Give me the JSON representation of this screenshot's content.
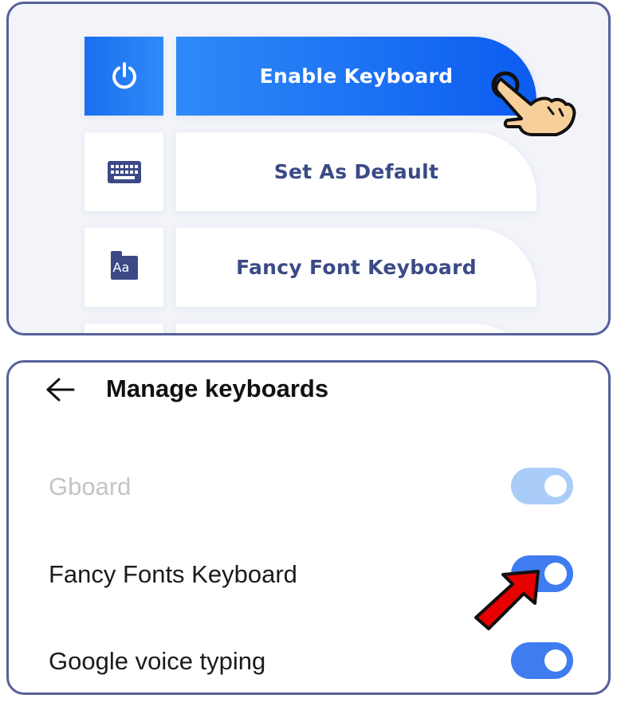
{
  "menu": {
    "items": [
      {
        "label": "Enable Keyboard",
        "icon": "power-icon",
        "active": true
      },
      {
        "label": "Set As Default",
        "icon": "keyboard-icon",
        "active": false
      },
      {
        "label": "Fancy Font Keyboard",
        "icon": "font-icon",
        "active": false
      }
    ]
  },
  "font_icon_text": "Aa",
  "manage": {
    "title": "Manage keyboards",
    "keyboards": [
      {
        "label": "Gboard",
        "enabled": true,
        "disabled": true
      },
      {
        "label": "Fancy Fonts Keyboard",
        "enabled": true,
        "disabled": false
      },
      {
        "label": "Google voice typing",
        "enabled": true,
        "disabled": false
      }
    ]
  },
  "colors": {
    "accent_blue": "#1a6ff0",
    "text_navy": "#3b4a86",
    "toggle_on": "#3e7cf0",
    "toggle_disabled": "#a9ccf9",
    "frame": "#56609a",
    "pointer_arrow": "#e60000"
  }
}
